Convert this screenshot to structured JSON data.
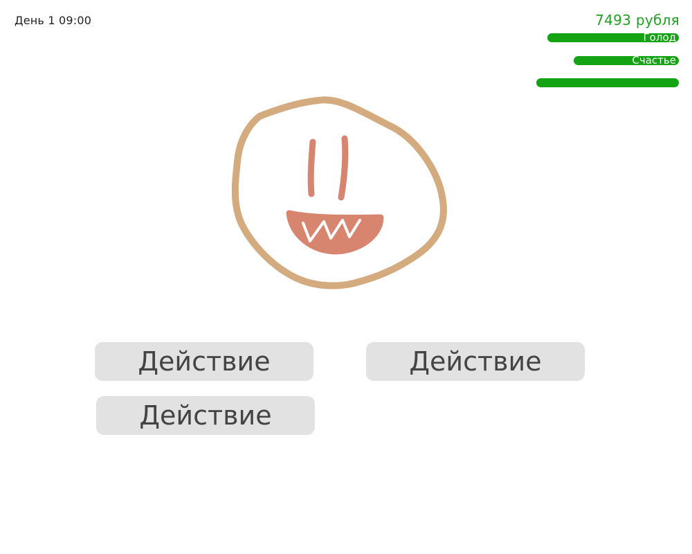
{
  "hud": {
    "day_time": "День 1 09:00",
    "money": "7493 рубля",
    "stats": [
      {
        "label": "Голод",
        "level": 0.92
      },
      {
        "label": "Счастье",
        "level": 0.74
      },
      {
        "label": "",
        "level": 1.0
      }
    ]
  },
  "character": {
    "icon": "smiling-face-drawing",
    "face_color": "#d3ab7e",
    "features_color": "#d88570"
  },
  "actions": [
    {
      "label": "Действие"
    },
    {
      "label": "Действие"
    },
    {
      "label": "Действие"
    }
  ],
  "colors": {
    "stat_bar": "#13a313",
    "money": "#1fa11f",
    "button_bg": "#e2e2e2",
    "button_text": "#444444"
  }
}
